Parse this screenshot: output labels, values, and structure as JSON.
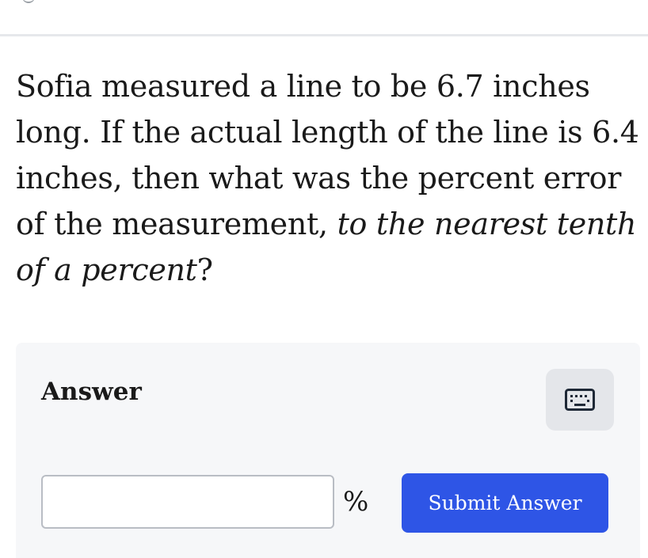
{
  "question": {
    "text_part1": "Sofia measured a line to be 6.7 inches long. If the actual length of the line is 6.4 inches, then what was the percent error of the measurement, ",
    "text_emphasis": "to the nearest tenth of a percent",
    "text_end": "?"
  },
  "answer": {
    "label": "Answer",
    "input_value": "",
    "unit": "%",
    "submit_label": "Submit Answer"
  },
  "icons": {
    "keyboard": "keyboard-icon"
  },
  "colors": {
    "submit_bg": "#2e55e6",
    "panel_bg": "#f6f7f9",
    "keyboard_bg": "#e4e6ea"
  }
}
